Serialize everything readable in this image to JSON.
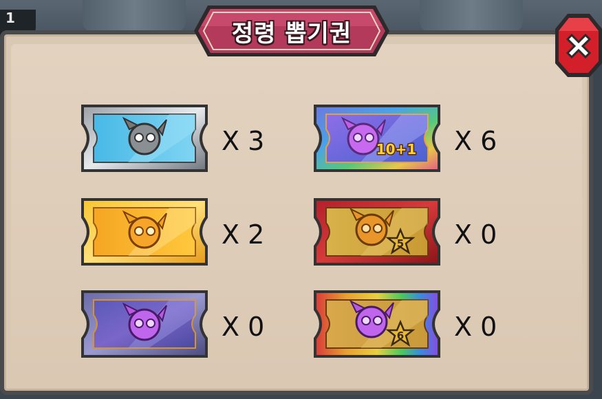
{
  "header": {
    "level_badge": "1",
    "title": "정령 뽑기권"
  },
  "close_icon": "close-x-icon",
  "colors": {
    "banner": "#b33a5a",
    "close_red": "#d21f2a",
    "panel": "#dac8b3"
  },
  "tickets": [
    {
      "name": "silver-ticket",
      "count": "X 3",
      "badge": ""
    },
    {
      "name": "rainbow-10plus1-ticket",
      "count": "X 6",
      "badge": "10+1"
    },
    {
      "name": "gold-ticket",
      "count": "X 2",
      "badge": ""
    },
    {
      "name": "red-5star-ticket",
      "count": "X 0",
      "badge": "5"
    },
    {
      "name": "purple-ticket",
      "count": "X 0",
      "badge": ""
    },
    {
      "name": "rainbow-6star-ticket",
      "count": "X 0",
      "badge": "6"
    }
  ]
}
